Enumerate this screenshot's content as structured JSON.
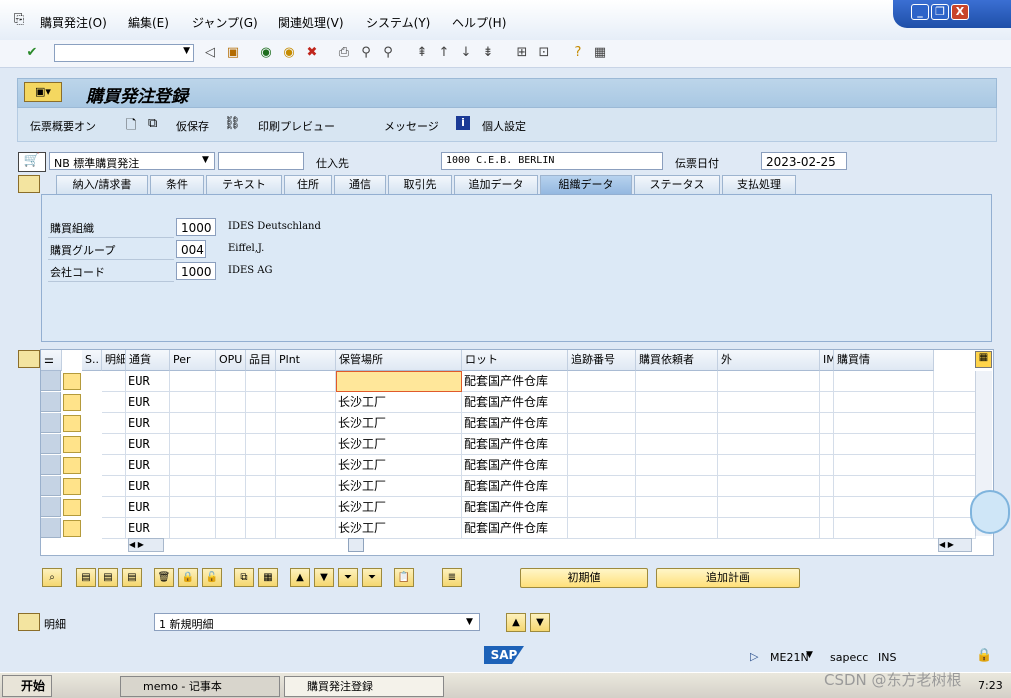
{
  "menu": {
    "items": [
      "購買発注(O)",
      "編集(E)",
      "ジャンプ(G)",
      "関連処理(V)",
      "システム(Y)",
      "ヘルプ(H)"
    ]
  },
  "window_controls": {
    "minimize": "_",
    "restore": "❐",
    "close": "X"
  },
  "title": "購買発注登録",
  "app_toolbar": {
    "doc_overview": "伝票概要オン",
    "hold": "仮保存",
    "print_preview": "印刷プレビュー",
    "messages": "メッセージ",
    "personal_settings": "個人設定"
  },
  "header": {
    "doc_type": "NB 標準購買発注",
    "doc_number": "",
    "vendor_label": "仕入先",
    "vendor": "1000 C.E.B. BERLIN",
    "doc_date_label": "伝票日付",
    "doc_date": "2023-02-25"
  },
  "tabs": [
    "納入/請求書",
    "条件",
    "テキスト",
    "住所",
    "通信",
    "取引先",
    "追加データ",
    "組織データ",
    "ステータス",
    "支払処理"
  ],
  "active_tab": "組織データ",
  "org": {
    "rows": [
      {
        "label": "購買組織",
        "value": "1000",
        "desc": "IDES Deutschland"
      },
      {
        "label": "購買グループ",
        "value": "004",
        "desc": "Eiffel,J."
      },
      {
        "label": "会社コード",
        "value": "1000",
        "desc": "IDES AG"
      }
    ]
  },
  "items_table": {
    "headers": [
      "S..",
      "明細",
      "通貨",
      "Per",
      "OPU",
      "品目 Group",
      "Plnt",
      "保管場所",
      "ロット",
      "追跡番号",
      "購買依頼者",
      "外",
      "IM 品目",
      "購買情"
    ],
    "rows": [
      {
        "currency": "EUR",
        "plant": "",
        "storage": "配套国产件仓库"
      },
      {
        "currency": "EUR",
        "plant": "长沙工厂",
        "storage": "配套国产件仓库"
      },
      {
        "currency": "EUR",
        "plant": "长沙工厂",
        "storage": "配套国产件仓库"
      },
      {
        "currency": "EUR",
        "plant": "长沙工厂",
        "storage": "配套国产件仓库"
      },
      {
        "currency": "EUR",
        "plant": "长沙工厂",
        "storage": "配套国产件仓库"
      },
      {
        "currency": "EUR",
        "plant": "长沙工厂",
        "storage": "配套国产件仓库"
      },
      {
        "currency": "EUR",
        "plant": "长沙工厂",
        "storage": "配套国产件仓库"
      },
      {
        "currency": "EUR",
        "plant": "长沙工厂",
        "storage": "配套国产件仓库"
      }
    ]
  },
  "buttons": {
    "default_values": "初期値",
    "add_planning": "追加計画"
  },
  "item_section": {
    "label": "明細",
    "selector": "1 新規明細"
  },
  "status": {
    "brand": "SAP",
    "transaction": "ME21N",
    "system": "sapecc",
    "mode": "INS"
  },
  "taskbar": {
    "start": "开始",
    "task1": "memo - 记事本",
    "task2": "購買発注登録",
    "time": "7:23",
    "watermark": "CSDN @东方老树根"
  }
}
